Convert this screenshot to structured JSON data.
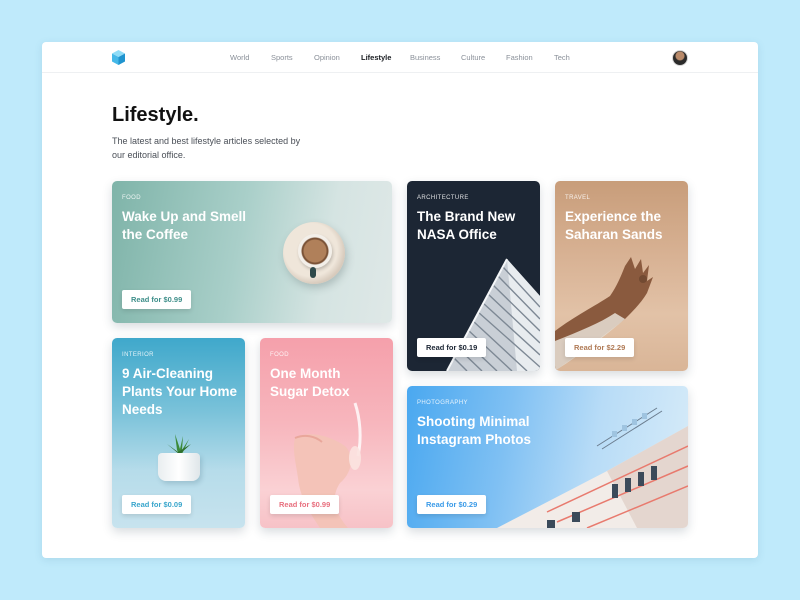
{
  "nav": {
    "items": [
      {
        "label": "World",
        "active": false
      },
      {
        "label": "Sports",
        "active": false
      },
      {
        "label": "Opinion",
        "active": false
      },
      {
        "label": "Lifestyle",
        "active": true
      },
      {
        "label": "Business",
        "active": false
      },
      {
        "label": "Culture",
        "active": false
      },
      {
        "label": "Fashion",
        "active": false
      },
      {
        "label": "Tech",
        "active": false
      }
    ]
  },
  "header": {
    "title": "Lifestyle.",
    "description": "The latest and best lifestyle articles selected by our editorial office."
  },
  "cards": [
    {
      "category": "FOOD",
      "title": "Wake Up and Smell the Coffee",
      "button": "Read for $0.99",
      "button_color": "#3f8f8a"
    },
    {
      "category": "ARCHITECTURE",
      "title": "The Brand New NASA Office",
      "button": "Read for $0.19",
      "button_color": "#1c2634"
    },
    {
      "category": "TRAVEL",
      "title": "Experience the Saharan Sands",
      "button": "Read for $2.29",
      "button_color": "#b07a55"
    },
    {
      "category": "INTERIOR",
      "title": "9 Air-Cleaning Plants Your Home Needs",
      "button": "Read for $0.09",
      "button_color": "#3aa6cc"
    },
    {
      "category": "FOOD",
      "title": "One Month Sugar Detox",
      "button": "Read for $0.99",
      "button_color": "#e8707f"
    },
    {
      "category": "PHOTOGRAPHY",
      "title": "Shooting Minimal Instagram Photos",
      "button": "Read for $0.29",
      "button_color": "#3b9be8"
    }
  ],
  "icons": {
    "logo": "cube-logo-icon",
    "avatar": "user-avatar"
  },
  "colors": {
    "background": "#bfeafb",
    "accent_logo": "#45b8e8"
  }
}
